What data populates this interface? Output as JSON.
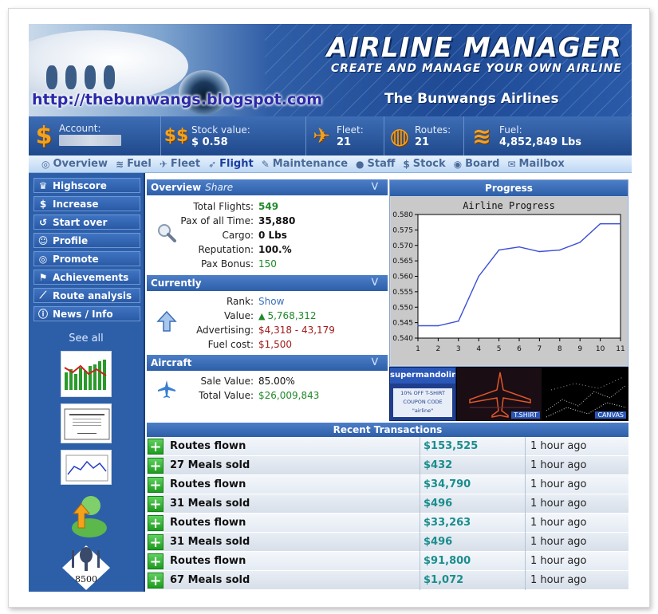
{
  "banner": {
    "title": "AIRLINE MANAGER",
    "subtitle": "CREATE AND MANAGE YOUR OWN AIRLINE",
    "blog_url": "http://thebunwangs.blogspot.com",
    "airline_name": "The Bunwangs Airlines"
  },
  "stats": [
    {
      "label": "Account:",
      "value": "",
      "icon": "dollar-icon",
      "glyph": "$"
    },
    {
      "label": "Stock value:",
      "value": "$ 0.58",
      "icon": "stock-dollars-icon",
      "glyph": "$$"
    },
    {
      "label": "Fleet:",
      "value": "21",
      "icon": "plane-icon",
      "glyph": "✈"
    },
    {
      "label": "Routes:",
      "value": "21",
      "icon": "globe-icon",
      "glyph": "◍"
    },
    {
      "label": "Fuel:",
      "value": "4,852,849 Lbs",
      "icon": "fuel-waves-icon",
      "glyph": "≋"
    }
  ],
  "nav": [
    {
      "label": "Overview",
      "icon": "overview-icon",
      "glyph": "◎"
    },
    {
      "label": "Fuel",
      "icon": "fuel-icon",
      "glyph": "≋"
    },
    {
      "label": "Fleet",
      "icon": "fleet-icon",
      "glyph": "✈"
    },
    {
      "label": "Flight",
      "icon": "flight-icon",
      "glyph": "➶",
      "active": true
    },
    {
      "label": "Maintenance",
      "icon": "wrench-icon",
      "glyph": "✎"
    },
    {
      "label": "Staff",
      "icon": "staff-icon",
      "glyph": "●"
    },
    {
      "label": "Stock",
      "icon": "stock-icon",
      "glyph": "$"
    },
    {
      "label": "Board",
      "icon": "board-icon",
      "glyph": "◉"
    },
    {
      "label": "Mailbox",
      "icon": "mail-icon",
      "glyph": "✉"
    }
  ],
  "sidebar": {
    "items": [
      {
        "label": "Highscore",
        "icon": "crown-icon",
        "glyph": "♛"
      },
      {
        "label": "Increase",
        "icon": "dollar-icon",
        "glyph": "$"
      },
      {
        "label": "Start over",
        "icon": "restart-icon",
        "glyph": "↺"
      },
      {
        "label": "Profile",
        "icon": "profile-icon",
        "glyph": "☺"
      },
      {
        "label": "Promote",
        "icon": "promote-icon",
        "glyph": "◎"
      },
      {
        "label": "Achievements",
        "icon": "flag-icon",
        "glyph": "⚑"
      },
      {
        "label": "Route analysis",
        "icon": "chart-line-icon",
        "glyph": "⟋"
      },
      {
        "label": "News / Info",
        "icon": "info-icon",
        "glyph": "ⓘ"
      }
    ],
    "see_all": "See all",
    "achievement_number": "8500"
  },
  "overview": {
    "title": "Overview",
    "share": "Share",
    "rows": [
      {
        "key": "Total Flights:",
        "value": "549",
        "style": "greenb"
      },
      {
        "key": "Pax of all Time:",
        "value": "35,880",
        "style": "bold"
      },
      {
        "key": "Cargo:",
        "value": "0 Lbs",
        "style": "bold"
      },
      {
        "key": "Reputation:",
        "value": "100.%",
        "style": "bold"
      },
      {
        "key": "Pax Bonus:",
        "value": "150",
        "style": "green"
      }
    ]
  },
  "currently": {
    "title": "Currently",
    "rows": [
      {
        "key": "Rank:",
        "value": "Show",
        "style": "link"
      },
      {
        "key": "Value:",
        "value": "5,768,312",
        "style": "green"
      },
      {
        "key": "Advertising:",
        "value": "$4,318 - 43,179",
        "style": "red"
      },
      {
        "key": "Fuel cost:",
        "value": "$1,500",
        "style": "red"
      }
    ]
  },
  "aircraft": {
    "title": "Aircraft",
    "rows": [
      {
        "key": "Sale Value:",
        "value": "85.00%",
        "style": "plain"
      },
      {
        "key": "Total Value:",
        "value": "$26,009,843",
        "style": "green"
      }
    ]
  },
  "progress": {
    "header": "Progress"
  },
  "chart_data": {
    "type": "line",
    "title": "Airline Progress",
    "x": [
      1,
      2,
      3,
      4,
      5,
      6,
      7,
      8,
      9,
      10,
      11
    ],
    "series": [
      {
        "values": [
          0.544,
          0.544,
          0.5455,
          0.56,
          0.5685,
          0.5695,
          0.568,
          0.5685,
          0.571,
          0.577,
          0.577
        ]
      }
    ],
    "ylim": [
      0.54,
      0.58
    ],
    "yticks": [
      "0.580",
      "0.575",
      "0.570",
      "0.565",
      "0.560",
      "0.555",
      "0.550",
      "0.545",
      "0.540"
    ],
    "xticks": [
      "1",
      "2",
      "3",
      "4",
      "5",
      "6",
      "7",
      "8",
      "9",
      "10",
      "11"
    ],
    "grid": false,
    "line_color": "#3a4fd6"
  },
  "ads": {
    "ad1_brand": "supermandolini",
    "ad1_text1": "10% OFF T-SHIRT",
    "ad1_text2": "COUPON CODE",
    "ad1_code": "\"airline\"",
    "ad2_label": "T.SHIRT",
    "ad3_label": "CANVAS"
  },
  "transactions": {
    "header": "Recent Transactions",
    "rows": [
      {
        "desc": "Routes flown",
        "amount": "$153,525",
        "time": "1 hour ago"
      },
      {
        "desc": "27 Meals sold",
        "amount": "$432",
        "time": "1 hour ago"
      },
      {
        "desc": "Routes flown",
        "amount": "$34,790",
        "time": "1 hour ago"
      },
      {
        "desc": "31 Meals sold",
        "amount": "$496",
        "time": "1 hour ago"
      },
      {
        "desc": "Routes flown",
        "amount": "$33,263",
        "time": "1 hour ago"
      },
      {
        "desc": "31 Meals sold",
        "amount": "$496",
        "time": "1 hour ago"
      },
      {
        "desc": "Routes flown",
        "amount": "$91,800",
        "time": "1 hour ago"
      },
      {
        "desc": "67 Meals sold",
        "amount": "$1,072",
        "time": "1 hour ago"
      }
    ]
  }
}
